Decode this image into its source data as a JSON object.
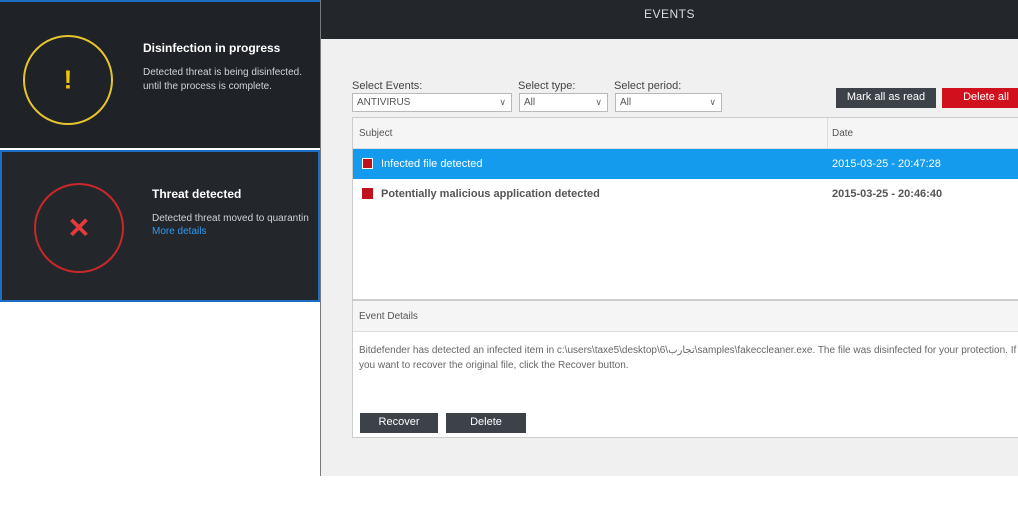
{
  "notifications": [
    {
      "title": "Disinfection in progress",
      "body": "Detected threat is being disinfected. until the process is complete.",
      "icon": "warning-icon",
      "glyph": "!",
      "color": "#e6c42e"
    },
    {
      "title": "Threat detected",
      "body": "Detected threat moved to quarantin",
      "link": "More details",
      "icon": "error-icon",
      "glyph": "✕",
      "color": "#c8282c"
    }
  ],
  "events": {
    "header_title": "EVENTS",
    "filters": {
      "events_label": "Select Events:",
      "events_value": "ANTIVIRUS",
      "type_label": "Select type:",
      "type_value": "All",
      "period_label": "Select period:",
      "period_value": "All"
    },
    "buttons": {
      "mark_all": "Mark all as read",
      "delete_all": "Delete all"
    },
    "table": {
      "col_subject": "Subject",
      "col_date": "Date",
      "rows": [
        {
          "subject": "Infected file detected",
          "date": "2015-03-25 - 20:47:28",
          "selected": true
        },
        {
          "subject": "Potentially malicious application detected",
          "date": "2015-03-25 - 20:46:40",
          "selected": false
        }
      ]
    },
    "details": {
      "heading": "Event Details",
      "text": "Bitdefender has detected an infected item in c:\\users\\taxe5\\desktop\\6\\تجارب\\samples\\fakeccleaner.exe. The file was disinfected for your protection. If you want to recover the original file, click the Recover button.",
      "recover": "Recover",
      "delete": "Delete"
    }
  },
  "colors": {
    "accent_blue": "#159bee",
    "danger_red": "#d0101c",
    "dark_header": "#23262b"
  }
}
